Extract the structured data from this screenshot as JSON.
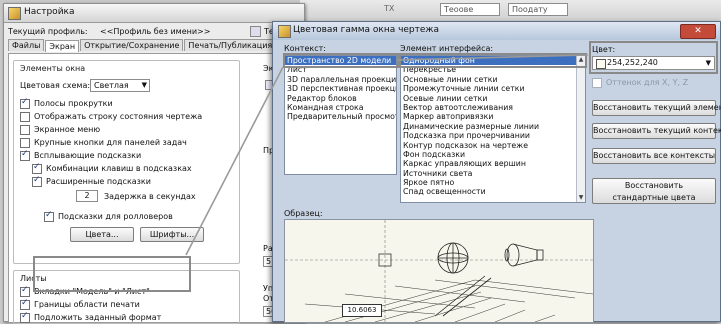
{
  "settings": {
    "title": "Настройка",
    "profile_label": "Текущий профиль:",
    "profile_value": "<<Профиль без имени>>",
    "profile_edge": "Те",
    "tabs": [
      "Файлы",
      "Экран",
      "Открытие/Сохранение",
      "Печать/Публикация"
    ],
    "window_elements": {
      "title": "Элементы окна",
      "color_scheme_label": "Цветовая схема:",
      "color_scheme_value": "Светлая",
      "checkboxes": [
        {
          "label": "Полосы прокрутки",
          "checked": true
        },
        {
          "label": "Отображать строку состояния чертежа",
          "checked": false
        },
        {
          "label": "Экранное меню",
          "checked": false
        },
        {
          "label": "Крупные кнопки для панелей задач",
          "checked": false
        },
        {
          "label": "Всплывающие подсказки",
          "checked": true
        },
        {
          "label": "Комбинации клавиш в подсказках",
          "checked": true
        },
        {
          "label": "Расширенные подсказки",
          "checked": true
        }
      ],
      "delay_value": "2",
      "delay_label": "Задержка в секундах",
      "rollover_label": "Подсказки для ролловеров",
      "rollover_checked": true,
      "colors_button": "Цвета...",
      "fonts_button": "Шрифты..."
    },
    "sheets": {
      "title": "Листы",
      "checkboxes": [
        {
          "label": "Вкладки \"Модель\" и \"Лист\"",
          "checked": true
        },
        {
          "label": "Границы области печати",
          "checked": true
        },
        {
          "label": "Подложить заданный формат",
          "checked": true
        }
      ]
    },
    "right_column_partial": {
      "top": "Экр",
      "middle": "Про",
      "lower": "Разм",
      "lower_value": "5",
      "bottom_1": "Упр",
      "bottom_2": "Отс",
      "bottom_value": "50"
    }
  },
  "scheme": {
    "title": "Цветовая гамма окна чертежа",
    "context_label": "Контекст:",
    "contexts": [
      "Пространство 2D модели",
      "Лист",
      "3D параллельная проекция",
      "3D перспективная проекция",
      "Редактор блоков",
      "Командная строка",
      "Предварительный просмотр"
    ],
    "element_label": "Элемент интерфейса:",
    "elements": [
      "Однородный фон",
      "Перекрестье",
      "Основные линии сетки",
      "Промежуточные линии сетки",
      "Осевые линии сетки",
      "Вектор автоотслеживания",
      "Маркер автопривязки",
      "Динамические размерные линии",
      "Подсказка при прочерчивании",
      "Контур подсказок на чертеже",
      "Фон подсказки",
      "Каркас управляющих вершин",
      "Источники света",
      "Яркое пятно",
      "Спад освещенности"
    ],
    "color_label": "Цвет:",
    "color_value": "254,252,240",
    "tint_label": "Оттенок для X, Y, Z",
    "buttons": {
      "restore_element": "Восстановить текущий элемент",
      "restore_context": "Восстановить текущий контекст",
      "restore_all": "Восстановить все контексты",
      "restore_classic": "Восстановить стандартные цвета"
    },
    "preview_label": "Образец:",
    "preview_dimension": "10.6063",
    "close_symbol": "✕"
  },
  "background": {
    "left_text": "Настройка",
    "field_1": "Теоове",
    "field_2": "Поодату",
    "fragment": "ТХ"
  },
  "colors": {
    "selection": "#3c6fbf",
    "highlight_frame": "#8a8a8a",
    "close_button": "#c44b3a"
  }
}
